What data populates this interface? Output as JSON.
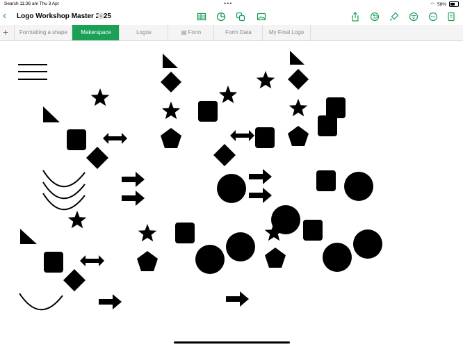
{
  "status": {
    "left": "Search   11:36 am   Thu 3 Apr",
    "dots": "•••",
    "battery": "58%"
  },
  "toolbar": {
    "title": "Logo Workshop Master 2025",
    "back": "‹",
    "chev": "⌄"
  },
  "tabs": [
    {
      "label": "Formatting a shape"
    },
    {
      "label": "Makerspace"
    },
    {
      "label": "Logos"
    },
    {
      "label": "Form"
    },
    {
      "label": "Form Data"
    },
    {
      "label": "My Final Logo"
    }
  ],
  "colors": {
    "accent": "#1aa155",
    "shape": "#000000"
  }
}
